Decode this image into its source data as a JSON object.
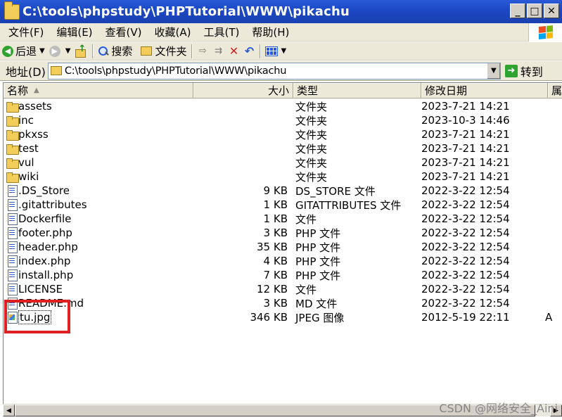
{
  "window": {
    "title": "C:\\tools\\phpstudy\\PHPTutorial\\WWW\\pikachu",
    "minimize": "_",
    "maximize": "□",
    "close": "✕"
  },
  "menu": {
    "items": [
      "文件(F)",
      "编辑(E)",
      "查看(V)",
      "收藏(A)",
      "工具(T)",
      "帮助(H)"
    ]
  },
  "toolbar": {
    "back": "后退",
    "search": "搜索",
    "folders": "文件夹"
  },
  "address": {
    "label": "地址(D)",
    "path": "C:\\tools\\phpstudy\\PHPTutorial\\WWW\\pikachu",
    "go": "转到"
  },
  "columns": {
    "name": "名称",
    "size": "大小",
    "type": "类型",
    "date": "修改日期",
    "extra": "属"
  },
  "files": [
    {
      "name": "assets",
      "size": "",
      "type": "文件夹",
      "date": "2023-7-21 14:21",
      "icon": "folder-icon"
    },
    {
      "name": "inc",
      "size": "",
      "type": "文件夹",
      "date": "2023-10-3 14:46",
      "icon": "folder-icon"
    },
    {
      "name": "pkxss",
      "size": "",
      "type": "文件夹",
      "date": "2023-7-21 14:21",
      "icon": "folder-icon"
    },
    {
      "name": "test",
      "size": "",
      "type": "文件夹",
      "date": "2023-7-21 14:21",
      "icon": "folder-icon"
    },
    {
      "name": "vul",
      "size": "",
      "type": "文件夹",
      "date": "2023-7-21 14:21",
      "icon": "folder-icon"
    },
    {
      "name": "wiki",
      "size": "",
      "type": "文件夹",
      "date": "2023-7-21 14:21",
      "icon": "folder-icon"
    },
    {
      "name": ".DS_Store",
      "size": "9 KB",
      "type": "DS_STORE 文件",
      "date": "2022-3-22 12:54",
      "icon": "file-icon"
    },
    {
      "name": ".gitattributes",
      "size": "1 KB",
      "type": "GITATTRIBUTES 文件",
      "date": "2022-3-22 12:54",
      "icon": "file-icon"
    },
    {
      "name": "Dockerfile",
      "size": "1 KB",
      "type": "文件",
      "date": "2022-3-22 12:54",
      "icon": "file-icon"
    },
    {
      "name": "footer.php",
      "size": "3 KB",
      "type": "PHP 文件",
      "date": "2022-3-22 12:54",
      "icon": "file-icon"
    },
    {
      "name": "header.php",
      "size": "35 KB",
      "type": "PHP 文件",
      "date": "2022-3-22 12:54",
      "icon": "file-icon"
    },
    {
      "name": "index.php",
      "size": "4 KB",
      "type": "PHP 文件",
      "date": "2022-3-22 12:54",
      "icon": "file-icon"
    },
    {
      "name": "install.php",
      "size": "7 KB",
      "type": "PHP 文件",
      "date": "2022-3-22 12:54",
      "icon": "file-icon"
    },
    {
      "name": "LICENSE",
      "size": "12 KB",
      "type": "文件",
      "date": "2022-3-22 12:54",
      "icon": "file-icon"
    },
    {
      "name": "README.md",
      "size": "3 KB",
      "type": "MD 文件",
      "date": "2022-3-22 12:54",
      "icon": "file-icon"
    },
    {
      "name": "tu.jpg",
      "size": "346 KB",
      "type": "JPEG 图像",
      "date": "2012-5-19 22:11",
      "extra": "A",
      "icon": "image-icon",
      "selected": true
    }
  ],
  "watermark": "CSDN @网络安全_Aini"
}
